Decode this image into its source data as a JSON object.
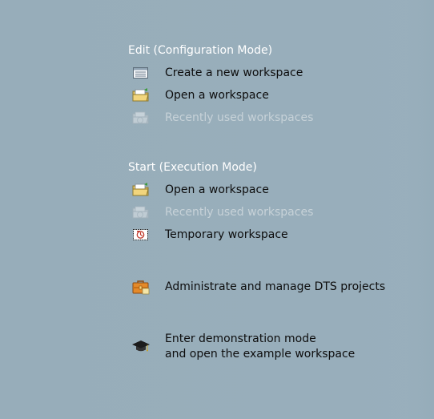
{
  "edit_section": {
    "title": "Edit (Configuration Mode)",
    "items": [
      {
        "label": "Create a new workspace",
        "icon": "new-workspace-icon"
      },
      {
        "label": "Open a workspace",
        "icon": "open-folder-icon"
      },
      {
        "label": "Recently used workspaces",
        "icon": "recent-folder-icon",
        "disabled": true
      }
    ]
  },
  "start_section": {
    "title": "Start (Execution Mode)",
    "items": [
      {
        "label": "Open a workspace",
        "icon": "open-folder-icon"
      },
      {
        "label": "Recently used workspaces",
        "icon": "recent-folder-icon",
        "disabled": true
      },
      {
        "label": "Temporary workspace",
        "icon": "temporary-workspace-icon"
      }
    ]
  },
  "admin": {
    "label": "Administrate and manage DTS projects",
    "icon": "briefcase-icon"
  },
  "demo": {
    "label_line1": "Enter demonstration mode",
    "label_line2": "and open the example workspace",
    "icon": "graduation-cap-icon"
  },
  "colors": {
    "background": "#98aebb",
    "section_title": "#ffffff",
    "item_text": "#0d0d0d",
    "disabled_text": "#c7d2d8"
  }
}
